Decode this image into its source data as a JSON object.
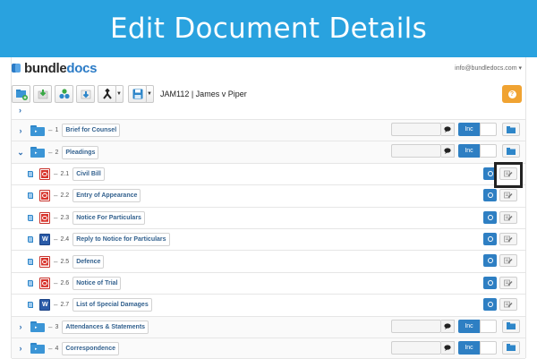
{
  "banner": {
    "title": "Edit Document Details"
  },
  "app": {
    "logo_main": "bundle",
    "logo_accent": "docs",
    "user_email": "info@bundledocs.com",
    "bundle_title": "JAM112 | James v Piper",
    "collapse_glyph": "›",
    "help_glyph": "?"
  },
  "toolbar_icons": [
    "add-folder-icon",
    "import-icon",
    "share-icon",
    "download-icon",
    "merge-icon",
    "save-icon"
  ],
  "rows": [
    {
      "kind": "folder",
      "caret": "›",
      "number": "1",
      "name": "Brief for Counsel",
      "toggle": "Inc"
    },
    {
      "kind": "folder",
      "caret": "⌄",
      "number": "2",
      "name": "Pleadings",
      "toggle": "Inc"
    },
    {
      "kind": "doc",
      "type": "pdf",
      "number": "2.1",
      "name": "Civil Bill"
    },
    {
      "kind": "doc",
      "type": "pdf",
      "number": "2.2",
      "name": "Entry of Appearance"
    },
    {
      "kind": "doc",
      "type": "pdf",
      "number": "2.3",
      "name": "Notice For Particulars"
    },
    {
      "kind": "doc",
      "type": "word",
      "number": "2.4",
      "name": "Reply to Notice for Particulars"
    },
    {
      "kind": "doc",
      "type": "pdf",
      "number": "2.5",
      "name": "Defence"
    },
    {
      "kind": "doc",
      "type": "pdf",
      "number": "2.6",
      "name": "Notice of Trial"
    },
    {
      "kind": "doc",
      "type": "word",
      "number": "2.7",
      "name": "List of Special Damages"
    },
    {
      "kind": "folder",
      "caret": "›",
      "number": "3",
      "name": "Attendances & Statements",
      "toggle": "Inc"
    },
    {
      "kind": "folder",
      "caret": "›",
      "number": "4",
      "name": "Correspondence",
      "toggle": "Inc"
    }
  ],
  "colors": {
    "banner": "#29a2df",
    "accent": "#2e7fc3",
    "help": "#f0a332",
    "pdf": "#d8342c",
    "word": "#2a5ba8"
  }
}
